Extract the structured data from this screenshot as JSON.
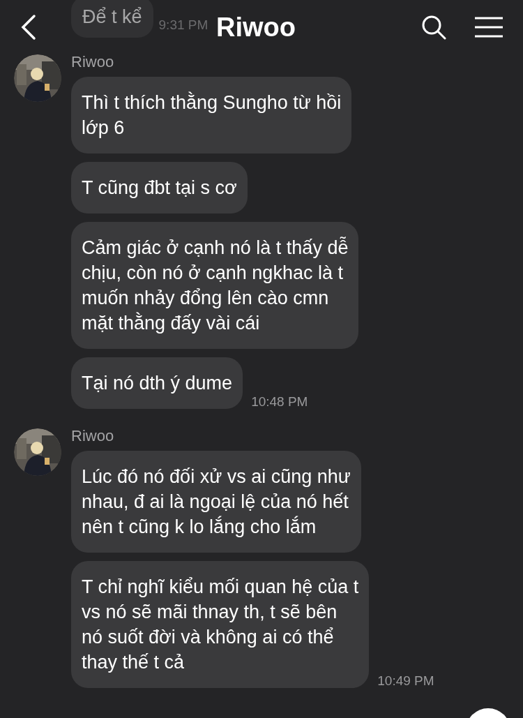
{
  "header": {
    "title": "Riwoo"
  },
  "earlier_message": {
    "text": "Để t kể",
    "time": "9:31 PM"
  },
  "groups": [
    {
      "sender": "Riwoo",
      "time": "10:48 PM",
      "messages": [
        {
          "lines": [
            "Thì t thích thằng Sungho từ hồi",
            "lớp 6"
          ]
        },
        {
          "lines": [
            "T cũng đbt tại s cơ"
          ]
        },
        {
          "lines": [
            "Cảm giác ở cạnh nó là t thấy dễ",
            "chịu, còn nó ở cạnh ngkhac là t",
            "muốn nhảy đổng lên cào cmn",
            "mặt thằng đấy vài cái"
          ]
        },
        {
          "lines": [
            "Tại nó dth ý dume"
          ]
        }
      ]
    },
    {
      "sender": "Riwoo",
      "time": "10:49 PM",
      "messages": [
        {
          "lines": [
            "Lúc đó nó đối xử vs ai cũng như",
            "nhau, đ ai là ngoại lệ của nó hết",
            "nên t cũng k lo lắng cho lắm"
          ]
        },
        {
          "lines": [
            "T chỉ nghĩ kiểu mối quan hệ của t",
            "vs nó sẽ mãi thnay th, t sẽ bên",
            "nó suốt đời và không ai có thể",
            "thay thế t cả"
          ]
        }
      ]
    }
  ]
}
